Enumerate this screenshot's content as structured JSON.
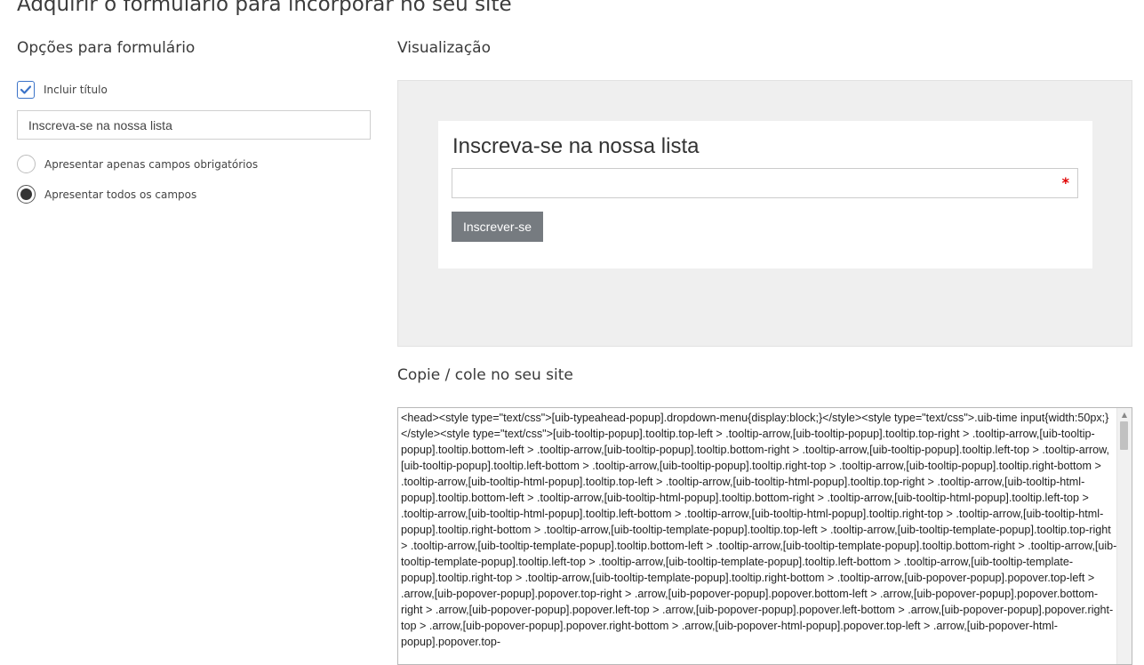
{
  "page": {
    "title": "Adquirir o formulário para incorporar no seu site"
  },
  "options": {
    "heading": "Opções para formulário",
    "include_title_label": "Incluir título",
    "include_title_checked": true,
    "title_value": "Inscreva-se na nossa lista",
    "radio_required_label": "Apresentar apenas campos obrigatórios",
    "radio_all_label": "Apresentar todos os campos",
    "selected_radio": "all"
  },
  "preview": {
    "heading": "Visualização",
    "form_title": "Inscreva-se na nossa lista",
    "required_marker": "*",
    "submit_label": "Inscrever-se"
  },
  "code": {
    "heading": "Copie / cole no seu site",
    "text": "<head><style type=\"text/css\">[uib-typeahead-popup].dropdown-menu{display:block;}</style><style type=\"text/css\">.uib-time input{width:50px;}</style><style type=\"text/css\">[uib-tooltip-popup].tooltip.top-left > .tooltip-arrow,[uib-tooltip-popup].tooltip.top-right > .tooltip-arrow,[uib-tooltip-popup].tooltip.bottom-left > .tooltip-arrow,[uib-tooltip-popup].tooltip.bottom-right > .tooltip-arrow,[uib-tooltip-popup].tooltip.left-top > .tooltip-arrow,[uib-tooltip-popup].tooltip.left-bottom > .tooltip-arrow,[uib-tooltip-popup].tooltip.right-top > .tooltip-arrow,[uib-tooltip-popup].tooltip.right-bottom > .tooltip-arrow,[uib-tooltip-html-popup].tooltip.top-left > .tooltip-arrow,[uib-tooltip-html-popup].tooltip.top-right > .tooltip-arrow,[uib-tooltip-html-popup].tooltip.bottom-left > .tooltip-arrow,[uib-tooltip-html-popup].tooltip.bottom-right > .tooltip-arrow,[uib-tooltip-html-popup].tooltip.left-top > .tooltip-arrow,[uib-tooltip-html-popup].tooltip.left-bottom > .tooltip-arrow,[uib-tooltip-html-popup].tooltip.right-top > .tooltip-arrow,[uib-tooltip-html-popup].tooltip.right-bottom > .tooltip-arrow,[uib-tooltip-template-popup].tooltip.top-left > .tooltip-arrow,[uib-tooltip-template-popup].tooltip.top-right > .tooltip-arrow,[uib-tooltip-template-popup].tooltip.bottom-left > .tooltip-arrow,[uib-tooltip-template-popup].tooltip.bottom-right > .tooltip-arrow,[uib-tooltip-template-popup].tooltip.left-top > .tooltip-arrow,[uib-tooltip-template-popup].tooltip.left-bottom > .tooltip-arrow,[uib-tooltip-template-popup].tooltip.right-top > .tooltip-arrow,[uib-tooltip-template-popup].tooltip.right-bottom > .tooltip-arrow,[uib-popover-popup].popover.top-left > .arrow,[uib-popover-popup].popover.top-right > .arrow,[uib-popover-popup].popover.bottom-left > .arrow,[uib-popover-popup].popover.bottom-right > .arrow,[uib-popover-popup].popover.left-top > .arrow,[uib-popover-popup].popover.left-bottom > .arrow,[uib-popover-popup].popover.right-top > .arrow,[uib-popover-popup].popover.right-bottom > .arrow,[uib-popover-html-popup].popover.top-left > .arrow,[uib-popover-html-popup].popover.top-"
  },
  "icons": {
    "checkbox": "checkmark-icon",
    "scroll_up": "chevron-up-icon"
  },
  "colors": {
    "accent": "#3b73c8",
    "preview_bg": "#efefef",
    "button_bg": "#767b80",
    "required": "#e00000"
  }
}
